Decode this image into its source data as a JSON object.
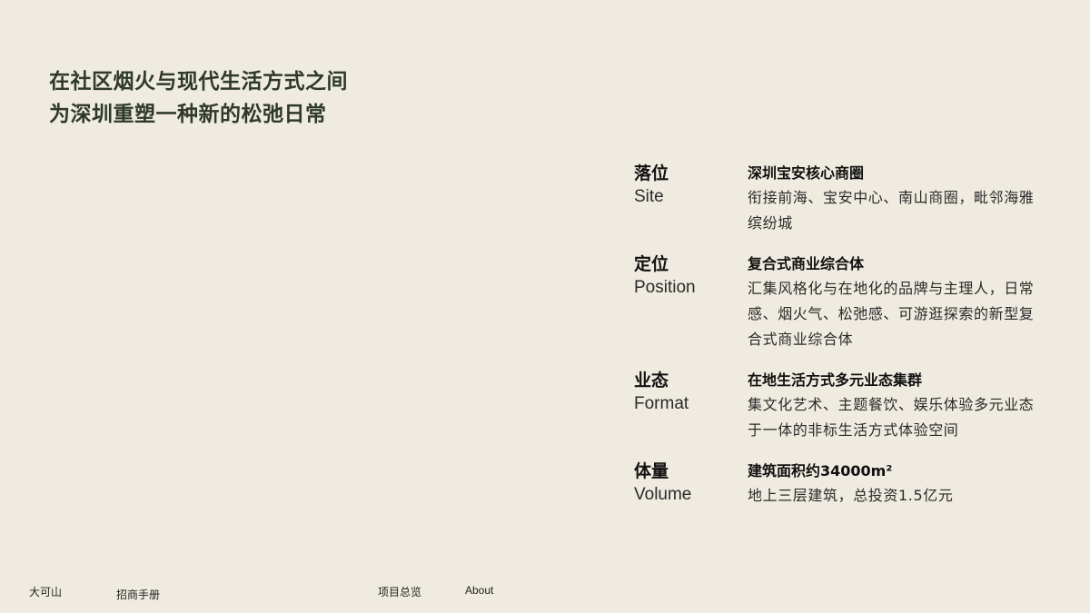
{
  "headline": {
    "line1": "在社区烟火与现代生活方式之间",
    "line2": "为深圳重塑一种新的松弛日常"
  },
  "info": [
    {
      "label_cn": "落位",
      "label_en": "Site",
      "title": "深圳宝安核心商圈",
      "desc": "衔接前海、宝安中心、南山商圈，毗邻海雅缤纷城"
    },
    {
      "label_cn": "定位",
      "label_en": "Position",
      "title": "复合式商业综合体",
      "desc": "汇集风格化与在地化的品牌与主理人，日常感、烟火气、松弛感、可游逛探索的新型复合式商业综合体"
    },
    {
      "label_cn": "业态",
      "label_en": "Format",
      "title": "在地生活方式多元业态集群",
      "desc": "集文化艺术、主题餐饮、娱乐体验多元业态于一体的非标生活方式体验空间"
    },
    {
      "label_cn": "体量",
      "label_en": "Volume",
      "title": "建筑面积约34000m²",
      "desc": "地上三层建筑，总投资1.5亿元"
    }
  ],
  "footer": {
    "brand": "大可山",
    "manual": "招商手册",
    "overview": "项目总览",
    "about": "About"
  }
}
